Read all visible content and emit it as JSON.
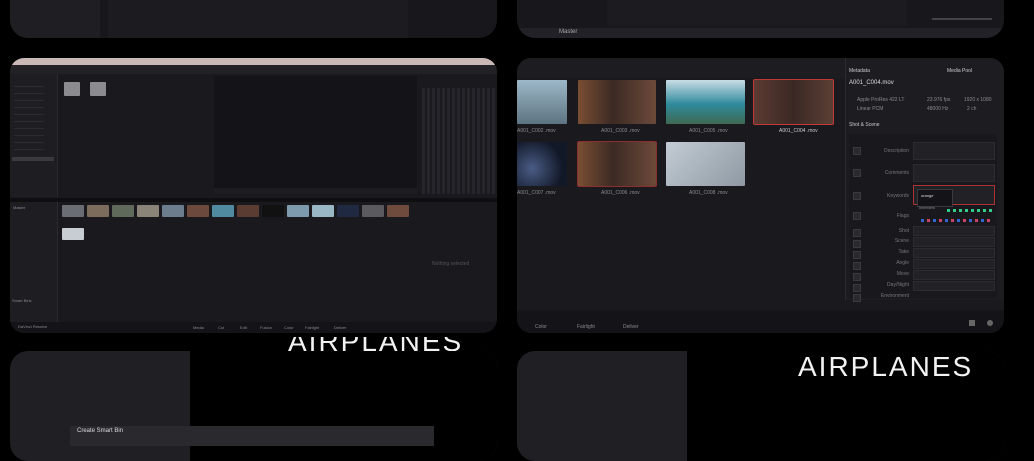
{
  "top_left_panel": {},
  "top_right_panel": {
    "master_label": "Master"
  },
  "left_editor": {
    "bins": [
      "Master"
    ],
    "clip_bar_label": "Nothing selected",
    "bottom_label": "Smart Bins",
    "footer_tabs": [
      "Media",
      "Cut",
      "Edit",
      "Fusion",
      "Color",
      "Fairlight",
      "Deliver"
    ],
    "status_label": "DaVinci Resolve"
  },
  "right_editor": {
    "thumbnails": [
      {
        "label": "A001_C002 .mov",
        "color": "#6f93a8"
      },
      {
        "label": "A001_C003 .mov",
        "color": "#6a4a3a"
      },
      {
        "label": "A001_C005 .mov",
        "color": "#4d8da0"
      },
      {
        "label": "A001_C004 .mov",
        "color": "#5c3b32"
      },
      {
        "label": "A001_C007 .mov",
        "color": "#1e2a44"
      },
      {
        "label": "A001_C006 .mov",
        "color": "#6b4e3e"
      },
      {
        "label": "A001_C008 .mov",
        "color": "#9aa4ad"
      }
    ],
    "metadata": {
      "header": "Metadata",
      "media_pool_label": "Media Pool",
      "clip_name": "A001_C004.mov",
      "info_rows": [
        {
          "name": "Apple ProRes 422 LT",
          "v1": "23.976 fps",
          "v2": "1920 x 1080"
        },
        {
          "name": "Linear PCM",
          "v1": "48000 Hz",
          "v2": "2 ch"
        }
      ],
      "section": "Shot & Scene",
      "fields": [
        "Description",
        "Comments",
        "Keywords",
        "Flags",
        "Shot",
        "Scene",
        "Take",
        "Angle",
        "Move",
        "Day/Night",
        "Environment"
      ],
      "keyword_value": "orange",
      "keyword_option": "Interview"
    },
    "footer_tabs": [
      "Color",
      "Fairlight",
      "Deliver"
    ]
  },
  "bottom_left_panel": {
    "menu_label": "Create Smart Bin"
  },
  "bottom_right_panel": {
    "title": "AIRPLANES"
  },
  "partial_title": "AIRPLANES"
}
